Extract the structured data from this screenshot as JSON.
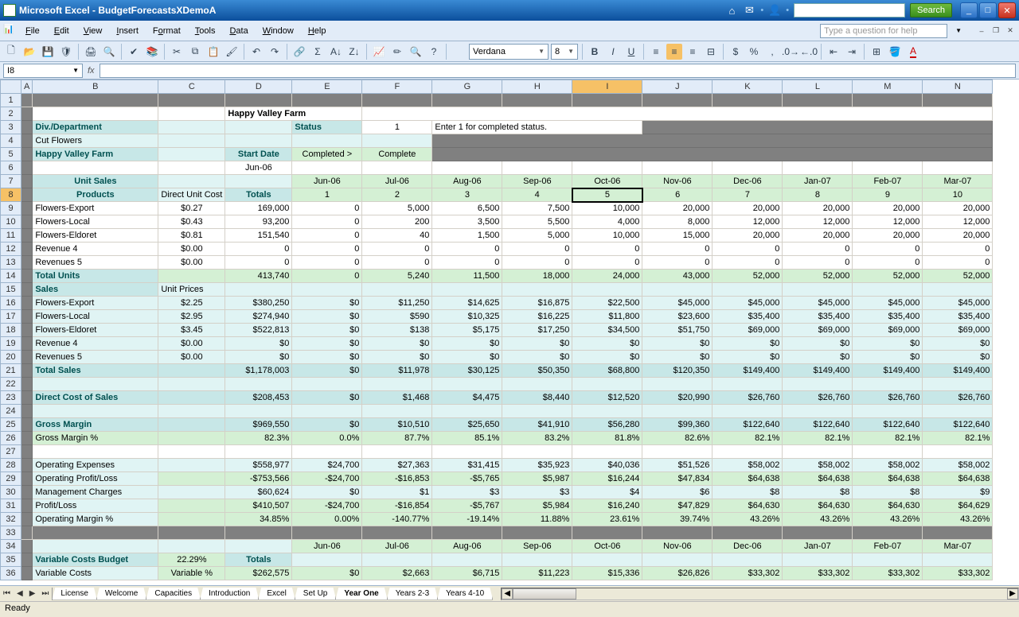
{
  "window": {
    "title": "Microsoft Excel - BudgetForecastsXDemoA",
    "search_btn": "Search"
  },
  "menu": {
    "items": [
      "File",
      "Edit",
      "View",
      "Insert",
      "Format",
      "Tools",
      "Data",
      "Window",
      "Help"
    ],
    "help_placeholder": "Type a question for help"
  },
  "toolbar": {
    "font": "Verdana",
    "size": "8"
  },
  "namebox": "I8",
  "status": "Ready",
  "tabs": {
    "items": [
      "License",
      "Welcome",
      "Capacities",
      "Introduction",
      "Excel",
      "Set Up",
      "Year One",
      "Years 2-3",
      "Years 4-10"
    ],
    "active": 6
  },
  "cols": [
    "A",
    "B",
    "C",
    "D",
    "E",
    "F",
    "G",
    "H",
    "I",
    "J",
    "K",
    "L",
    "M",
    "N"
  ],
  "sheet": {
    "r2": {
      "title": "Happy Valley Farm"
    },
    "r3": {
      "b": "Div./Department",
      "e": "Status",
      "f": "1",
      "g": "Enter 1 for completed status."
    },
    "r4": {
      "b": "   Cut Flowers"
    },
    "r5": {
      "b": " Happy Valley Farm",
      "d": "Start Date",
      "e": "Completed >",
      "f": "Complete"
    },
    "r6": {
      "d": "Jun-06"
    },
    "r7": {
      "b": "Unit Sales",
      "months": [
        "Jun-06",
        "Jul-06",
        "Aug-06",
        "Sep-06",
        "Oct-06",
        "Nov-06",
        "Dec-06",
        "Jan-07",
        "Feb-07",
        "Mar-07"
      ]
    },
    "r8": {
      "b": "Products",
      "c": "Direct Unit Cost",
      "d": "Totals",
      "nums": [
        "1",
        "2",
        "3",
        "4",
        "5",
        "6",
        "7",
        "8",
        "9",
        "10"
      ]
    },
    "r9": [
      "Flowers-Export",
      "$0.27",
      "169,000",
      "0",
      "5,000",
      "6,500",
      "7,500",
      "10,000",
      "20,000",
      "20,000",
      "20,000",
      "20,000",
      "20,000"
    ],
    "r10": [
      "Flowers-Local",
      "$0.43",
      "93,200",
      "0",
      "200",
      "3,500",
      "5,500",
      "4,000",
      "8,000",
      "12,000",
      "12,000",
      "12,000",
      "12,000"
    ],
    "r11": [
      "Flowers-Eldoret",
      "$0.81",
      "151,540",
      "0",
      "40",
      "1,500",
      "5,000",
      "10,000",
      "15,000",
      "20,000",
      "20,000",
      "20,000",
      "20,000"
    ],
    "r12": [
      "Revenue 4",
      "$0.00",
      "0",
      "0",
      "0",
      "0",
      "0",
      "0",
      "0",
      "0",
      "0",
      "0",
      "0"
    ],
    "r13": [
      "Revenues 5",
      "$0.00",
      "0",
      "0",
      "0",
      "0",
      "0",
      "0",
      "0",
      "0",
      "0",
      "0",
      "0"
    ],
    "r14": [
      "Total Units",
      "",
      "413,740",
      "0",
      "5,240",
      "11,500",
      "18,000",
      "24,000",
      "43,000",
      "52,000",
      "52,000",
      "52,000",
      "52,000"
    ],
    "r15": [
      "Sales",
      "Unit Prices",
      "",
      "",
      "",
      "",
      "",
      "",
      "",
      "",
      "",
      "",
      ""
    ],
    "r16": [
      "Flowers-Export",
      "$2.25",
      "$380,250",
      "$0",
      "$11,250",
      "$14,625",
      "$16,875",
      "$22,500",
      "$45,000",
      "$45,000",
      "$45,000",
      "$45,000",
      "$45,000"
    ],
    "r17": [
      "Flowers-Local",
      "$2.95",
      "$274,940",
      "$0",
      "$590",
      "$10,325",
      "$16,225",
      "$11,800",
      "$23,600",
      "$35,400",
      "$35,400",
      "$35,400",
      "$35,400"
    ],
    "r18": [
      "Flowers-Eldoret",
      "$3.45",
      "$522,813",
      "$0",
      "$138",
      "$5,175",
      "$17,250",
      "$34,500",
      "$51,750",
      "$69,000",
      "$69,000",
      "$69,000",
      "$69,000"
    ],
    "r19": [
      "Revenue 4",
      "$0.00",
      "$0",
      "$0",
      "$0",
      "$0",
      "$0",
      "$0",
      "$0",
      "$0",
      "$0",
      "$0",
      "$0"
    ],
    "r20": [
      "Revenues 5",
      "$0.00",
      "$0",
      "$0",
      "$0",
      "$0",
      "$0",
      "$0",
      "$0",
      "$0",
      "$0",
      "$0",
      "$0"
    ],
    "r21": [
      "Total Sales",
      "",
      "$1,178,003",
      "$0",
      "$11,978",
      "$30,125",
      "$50,350",
      "$68,800",
      "$120,350",
      "$149,400",
      "$149,400",
      "$149,400",
      "$149,400"
    ],
    "r23": [
      "Direct Cost of Sales",
      "",
      "$208,453",
      "$0",
      "$1,468",
      "$4,475",
      "$8,440",
      "$12,520",
      "$20,990",
      "$26,760",
      "$26,760",
      "$26,760",
      "$26,760"
    ],
    "r25": [
      "Gross Margin",
      "",
      "$969,550",
      "$0",
      "$10,510",
      "$25,650",
      "$41,910",
      "$56,280",
      "$99,360",
      "$122,640",
      "$122,640",
      "$122,640",
      "$122,640"
    ],
    "r26": [
      "Gross Margin %",
      "",
      "82.3%",
      "0.0%",
      "87.7%",
      "85.1%",
      "83.2%",
      "81.8%",
      "82.6%",
      "82.1%",
      "82.1%",
      "82.1%",
      "82.1%"
    ],
    "r28": [
      "Operating Expenses",
      "",
      "$558,977",
      "$24,700",
      "$27,363",
      "$31,415",
      "$35,923",
      "$40,036",
      "$51,526",
      "$58,002",
      "$58,002",
      "$58,002",
      "$58,002"
    ],
    "r29": [
      "Operating Profit/Loss",
      "",
      "-$753,566",
      "-$24,700",
      "-$16,853",
      "-$5,765",
      "$5,987",
      "$16,244",
      "$47,834",
      "$64,638",
      "$64,638",
      "$64,638",
      "$64,638"
    ],
    "r30": [
      "Management Charges",
      "",
      "$60,624",
      "$0",
      "$1",
      "$3",
      "$3",
      "$4",
      "$6",
      "$8",
      "$8",
      "$8",
      "$9"
    ],
    "r31": [
      "Profit/Loss",
      "",
      "$410,507",
      "-$24,700",
      "-$16,854",
      "-$5,767",
      "$5,984",
      "$16,240",
      "$47,829",
      "$64,630",
      "$64,630",
      "$64,630",
      "$64,629"
    ],
    "r32": [
      "Operating Margin %",
      "",
      "34.85%",
      "0.00%",
      "-140.77%",
      "-19.14%",
      "11.88%",
      "23.61%",
      "39.74%",
      "43.26%",
      "43.26%",
      "43.26%",
      "43.26%"
    ],
    "r34": {
      "months": [
        "Jun-06",
        "Jul-06",
        "Aug-06",
        "Sep-06",
        "Oct-06",
        "Nov-06",
        "Dec-06",
        "Jan-07",
        "Feb-07",
        "Mar-07"
      ]
    },
    "r35": [
      "Variable Costs Budget",
      "22.29%",
      "Totals",
      "",
      "",
      "",
      "",
      "",
      "",
      "",
      "",
      "",
      ""
    ],
    "r36": [
      "   Variable Costs",
      "Variable %",
      "$262,575",
      "$0",
      "$2,663",
      "$6,715",
      "$11,223",
      "$15,336",
      "$26,826",
      "$33,302",
      "$33,302",
      "$33,302",
      "$33,302"
    ]
  }
}
